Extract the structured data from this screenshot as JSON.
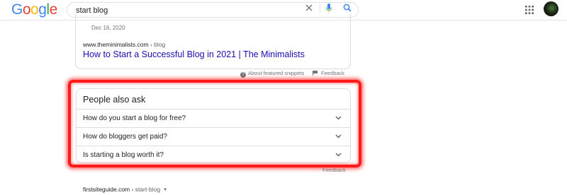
{
  "header": {
    "logo_letters": [
      "G",
      "o",
      "o",
      "g",
      "l",
      "e"
    ],
    "logo_colors": [
      "#4285f4",
      "#ea4335",
      "#fbbc05",
      "#4285f4",
      "#34a853",
      "#ea4335"
    ],
    "search_value": "start blog"
  },
  "snippet": {
    "date": "Dec 16, 2020",
    "cite_domain": "www.theminimalists.com",
    "cite_path": " › blog",
    "title": "How to Start a Successful Blog in 2021 | The Minimalists",
    "about_label": "About featured snippets",
    "feedback_label": "Feedback"
  },
  "people_also_ask": {
    "title": "People also ask",
    "questions": [
      "How do you start a blog for free?",
      "How do bloggers get paid?",
      "Is starting a blog worth it?"
    ],
    "feedback_label": "Feedback"
  },
  "next_result": {
    "cite_domain": "firstsiteguide.com",
    "cite_path": " › start-blog"
  },
  "colors": {
    "link": "#1a0dab",
    "highlight": "#ff1a1a",
    "mic": "#4285f4",
    "search": "#4285f4"
  },
  "icons": [
    "clear-icon",
    "mic-icon",
    "search-icon",
    "apps-icon",
    "help-icon",
    "flag-icon",
    "chevron-down-icon",
    "caret-down-icon"
  ]
}
